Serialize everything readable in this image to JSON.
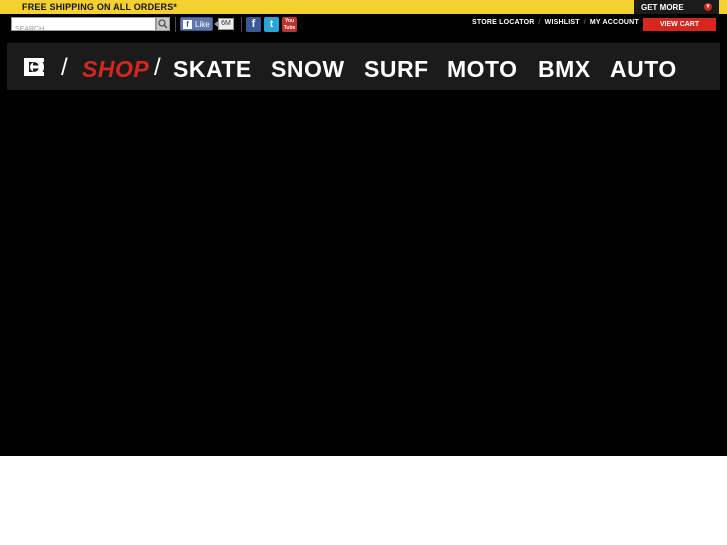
{
  "promo": {
    "text": "FREE SHIPPING ON ALL ORDERS*",
    "get_more_label": "GET MORE"
  },
  "search": {
    "placeholder": "SEARCH"
  },
  "social": {
    "like_label": "Like",
    "like_count": "6M",
    "icons": [
      "facebook-icon",
      "twitter-icon",
      "youtube-icon"
    ],
    "youtube_label": "You Tube"
  },
  "top_links": {
    "store_locator": "STORE LOCATOR",
    "wishlist": "WISHLIST",
    "my_account": "MY ACCOUNT",
    "separator": "/"
  },
  "cart": {
    "label": "VIEW CART"
  },
  "nav": {
    "slash": "/",
    "shop": "SHOP",
    "items": [
      "SKATE",
      "SNOW",
      "SURF",
      "MOTO",
      "BMX",
      "AUTO"
    ]
  },
  "colors": {
    "promo_bg": "#f4d130",
    "accent_red": "#d7261d",
    "nav_bg": "#1b1b1b",
    "page_bg": "#000000"
  }
}
